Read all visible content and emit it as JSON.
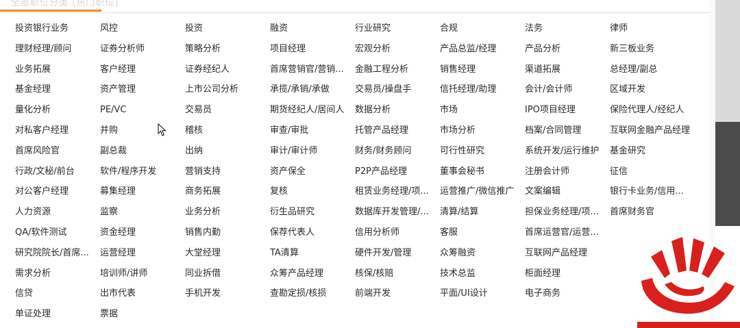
{
  "header": {
    "tab_title": "全部职位分类 (热门职位)"
  },
  "jobs": [
    "投资银行业务",
    "风控",
    "投资",
    "融资",
    "行业研究",
    "合规",
    "法务",
    "律师",
    "理财经理/顾问",
    "证券分析师",
    "策略分析",
    "项目经理",
    "宏观分析",
    "产品总监/经理",
    "产品分析",
    "新三板业务",
    "业务拓展",
    "客户经理",
    "证券经纪人",
    "首席营销官/营销...",
    "金融工程分析",
    "销售经理",
    "渠道拓展",
    "总经理/副总",
    "基金经理",
    "资产管理",
    "上市公司分析",
    "承揽/承销/承做",
    "交易员/操盘手",
    "信托经理/助理",
    "会计/会计师",
    "区域开发",
    "量化分析",
    "PE/VC",
    "交易员",
    "期货经纪人/居间人",
    "数据分析",
    "市场",
    "IPO项目经理",
    "保险代理人/经纪人",
    "对私客户经理",
    "并购",
    "稽核",
    "审查/审批",
    "托管产品经理",
    "市场分析",
    "档案/合同管理",
    "互联网金融产品经理",
    "首席风险官",
    "副总裁",
    "出纳",
    "审计/审计师",
    "财务/财务顾问",
    "可行性研究",
    "系统开发/运行维护",
    "基金研究",
    "行政/文秘/前台",
    "软件/程序开发",
    "营销支持",
    "资产保全",
    "P2P产品经理",
    "董事会秘书",
    "注册会计师",
    "征信",
    "对公客户经理",
    "募集经理",
    "商务拓展",
    "复核",
    "租赁业务经理/项...",
    "运营推广/微信推广",
    "文案编辑",
    "银行卡业务/信用...",
    "人力资源",
    "监察",
    "业务分析",
    "衍生品研究",
    "数据库开发管理/...",
    "清算/结算",
    "担保业务经理/项...",
    "首席财务官",
    "QA/软件测试",
    "资金经理",
    "销售内勤",
    "保荐代表人",
    "信用分析师",
    "客服",
    "首席运营官/运营...",
    "",
    "研究院院长/首席...",
    "运营经理",
    "大堂经理",
    "TA清算",
    "硬件开发/管理",
    "众筹融资",
    "互联网产品经理",
    "",
    "需求分析",
    "培训师/讲师",
    "同业拆借",
    "众筹产品经理",
    "核保/核赔",
    "技术总监",
    "柜面经理",
    "",
    "信贷",
    "出市代表",
    "手机开发",
    "查勘定损/核损",
    "前端开发",
    "平面/UI设计",
    "电子商务",
    "",
    "单证处理",
    "票据"
  ],
  "colors": {
    "accent": "#f08a24",
    "logo_red": "#d9201c",
    "text": "#2b2b2b"
  },
  "icons": {
    "cursor": "arrow-cursor-icon",
    "logo": "hand-logo-icon"
  }
}
